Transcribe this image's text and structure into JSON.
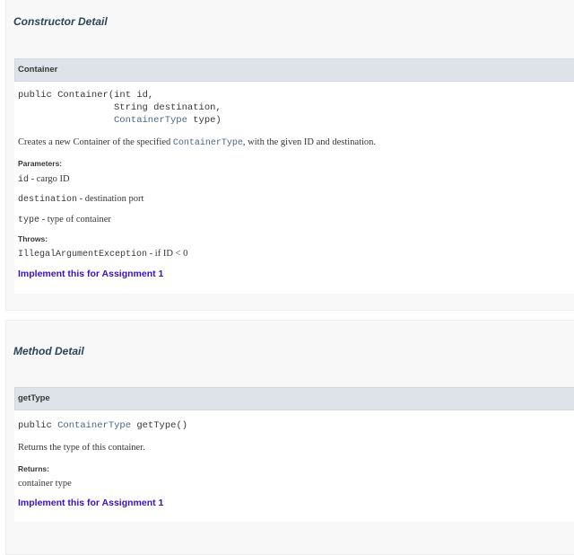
{
  "constructor_detail": {
    "title": "Constructor Detail",
    "member": {
      "name": "Container",
      "signature": {
        "line1_prefix": "public Container(int id,",
        "line2": "String destination,",
        "line3_type": "ContainerType",
        "line3_rest": " type)"
      },
      "description": {
        "before": "Creates a new Container of the specified ",
        "type": "ContainerType",
        "after": ", with the given ID and destination."
      },
      "parameters_label": "Parameters:",
      "parameters": [
        {
          "name": "id",
          "desc": " - cargo ID"
        },
        {
          "name": "destination",
          "desc": " - destination port"
        },
        {
          "name": "type",
          "desc": " - type of container"
        }
      ],
      "throws_label": "Throws:",
      "throws": {
        "name": "IllegalArgumentException",
        "desc": " - if ID < 0"
      },
      "note": "Implement this for Assignment 1"
    }
  },
  "method_detail": {
    "title": "Method Detail",
    "member": {
      "name": "getType",
      "signature": {
        "prefix": "public ",
        "type": "ContainerType",
        "rest": " getType()"
      },
      "description": "Returns the type of this container.",
      "returns_label": "Returns:",
      "returns": "container type",
      "note": "Implement this for Assignment 1"
    }
  },
  "colors": {
    "section_bg": "#f8f8f8",
    "header_bg": "#dee3e9",
    "title": "#2c4557",
    "type_link": "#4a6782",
    "note": "#3b10c8"
  }
}
